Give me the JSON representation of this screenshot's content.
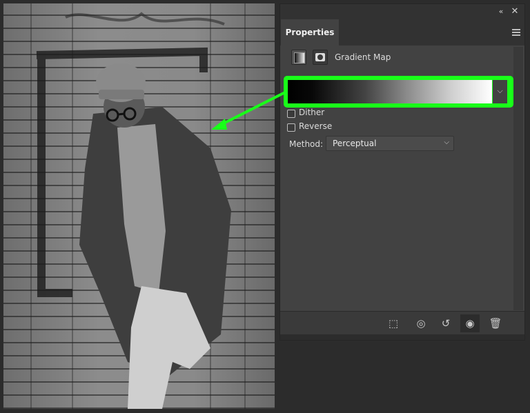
{
  "panel": {
    "tab_label": "Properties",
    "adjustment_label": "Gradient Map",
    "dither_label": "Dither",
    "dither_checked": false,
    "reverse_label": "Reverse",
    "reverse_checked": false,
    "method_label": "Method:",
    "method_value": "Perceptual",
    "gradient_colors": [
      "#000000",
      "#ffffff"
    ]
  },
  "titlebar": {
    "collapse_icon": "double-chevron-left-icon",
    "close_icon": "close-icon"
  },
  "bottom_toolbar": {
    "icons": [
      "clip-to-layer-icon",
      "view-previous-state-icon",
      "reset-icon",
      "visibility-eye-icon",
      "trash-icon"
    ]
  },
  "highlight_color": "#19ff19",
  "photo": {
    "description_icon": "photo-canvas"
  }
}
